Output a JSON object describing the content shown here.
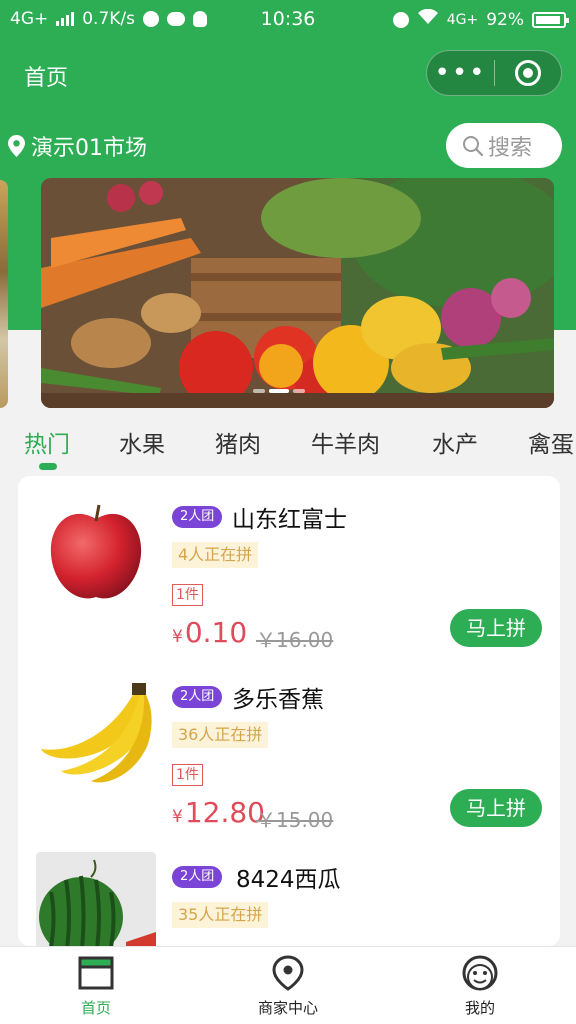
{
  "status_bar": {
    "network_left": "4G+",
    "speed": "0.7K/s",
    "time": "10:36",
    "network_right": "4G+",
    "battery": "92%"
  },
  "nav": {
    "title": "首页",
    "more_icon": "more-dots-icon",
    "target_icon": "target-icon"
  },
  "location": {
    "icon": "location-pin-icon",
    "market": "演示01市场"
  },
  "search": {
    "icon": "search-icon",
    "label": "搜索"
  },
  "categories": [
    "热门",
    "水果",
    "猪肉",
    "牛羊肉",
    "水产",
    "禽蛋"
  ],
  "active_category": "热门",
  "products": [
    {
      "badge": "2人团",
      "name": "山东红富士",
      "joining": "4人正在拼",
      "unit": "1件",
      "currency": "¥",
      "price": "0.10",
      "old_price": "￥16.00",
      "buy_label": "马上拼",
      "image": "apple"
    },
    {
      "badge": "2人团",
      "name": "多乐香蕉",
      "joining": "36人正在拼",
      "unit": "1件",
      "currency": "¥",
      "price": "12.80",
      "old_price": "￥15.00",
      "buy_label": "马上拼",
      "image": "banana"
    },
    {
      "badge": "2人团",
      "name": "8424西瓜",
      "joining": "35人正在拼",
      "image": "watermelon"
    }
  ],
  "tabbar": [
    {
      "label": "首页",
      "icon": "home-icon",
      "active": true
    },
    {
      "label": "商家中心",
      "icon": "location-icon",
      "active": false
    },
    {
      "label": "我的",
      "icon": "smiley-icon",
      "active": false
    }
  ],
  "colors": {
    "brand_green": "#2dae55",
    "price_red": "#e04b5a",
    "badge_purple": "#7a45d6",
    "joining_bg": "#fcf3d9"
  }
}
